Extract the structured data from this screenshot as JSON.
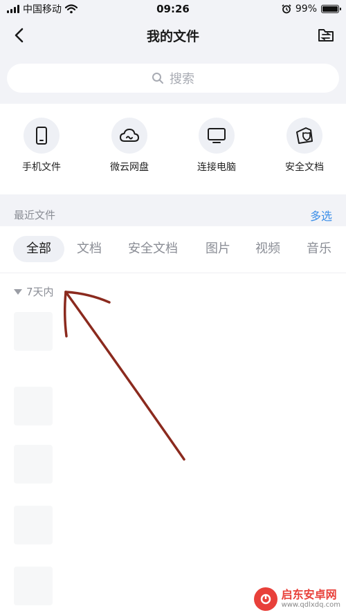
{
  "status_bar": {
    "carrier": "中国移动",
    "time": "09:26",
    "battery": "99%",
    "battery_level": 0.99
  },
  "nav": {
    "title": "我的文件"
  },
  "search": {
    "placeholder": "搜索"
  },
  "shortcuts": [
    {
      "label": "手机文件",
      "icon": "phone-icon"
    },
    {
      "label": "微云网盘",
      "icon": "cloud-icon"
    },
    {
      "label": "连接电脑",
      "icon": "monitor-icon"
    },
    {
      "label": "安全文档",
      "icon": "secure-document-icon"
    }
  ],
  "recent": {
    "title": "最近文件",
    "multi_select": "多选"
  },
  "tabs": [
    {
      "label": "全部",
      "active": true
    },
    {
      "label": "文档",
      "active": false
    },
    {
      "label": "安全文档",
      "active": false
    },
    {
      "label": "图片",
      "active": false
    },
    {
      "label": "视频",
      "active": false
    },
    {
      "label": "音乐",
      "active": false
    }
  ],
  "group": {
    "label": "7天内"
  },
  "files": [
    {
      "name": "",
      "meta": ""
    },
    {
      "name": "",
      "meta": ""
    },
    {
      "name": "",
      "meta": ""
    },
    {
      "name": "",
      "meta": ""
    },
    {
      "name": "",
      "meta": ""
    }
  ],
  "watermark": {
    "name": "启东安卓网",
    "url": "www.qdlxdq.com"
  },
  "colors": {
    "accent": "#3b8ee8",
    "background": "#f2f3f7",
    "annotation_arrow": "#8b2a1e"
  }
}
